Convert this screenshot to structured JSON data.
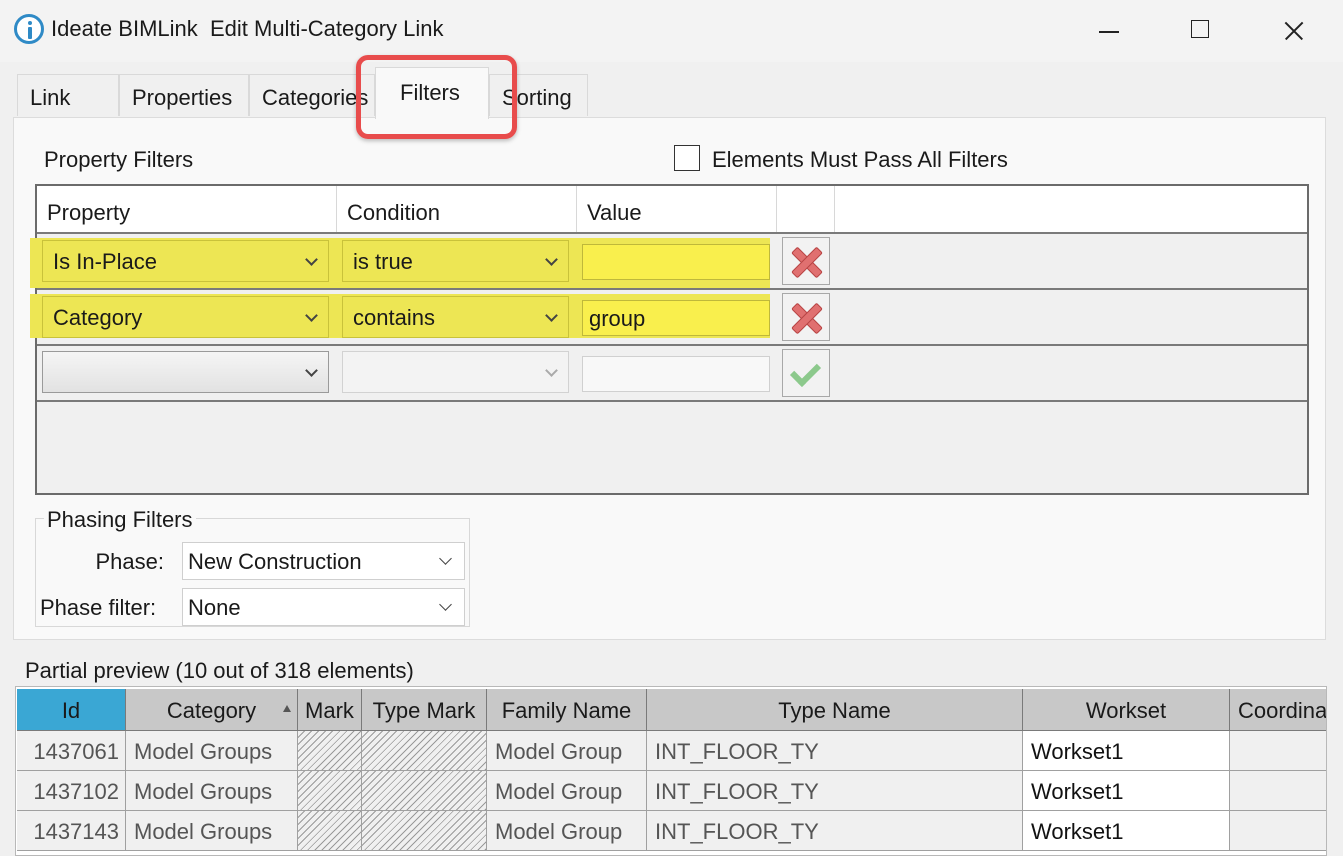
{
  "window": {
    "title": "Ideate BIMLink  Edit Multi-Category Link"
  },
  "tabs": [
    {
      "label": "Link"
    },
    {
      "label": "Properties"
    },
    {
      "label": "Categories"
    },
    {
      "label": "Filters"
    },
    {
      "label": "Sorting"
    }
  ],
  "active_tab": "Filters",
  "property_filters": {
    "label": "Property Filters",
    "must_pass_all_label": "Elements Must Pass All Filters",
    "must_pass_all_checked": false,
    "columns": [
      "Property",
      "Condition",
      "Value"
    ],
    "rows": [
      {
        "property": "Is In-Place",
        "condition": "is true",
        "value": "",
        "action": "remove-icon"
      },
      {
        "property": "Category",
        "condition": "contains",
        "value": "group",
        "action": "remove-icon"
      },
      {
        "property": "",
        "condition": "",
        "value": "",
        "action": "confirm-icon"
      }
    ],
    "highlight_color": "#ede654"
  },
  "phasing_filters": {
    "label": "Phasing Filters",
    "phase_label": "Phase:",
    "phase_value": "New Construction",
    "phase_filter_label": "Phase filter:",
    "phase_filter_value": "None"
  },
  "preview": {
    "label": "Partial preview (10 out of 318 elements)",
    "columns": [
      "Id",
      "Category",
      "Mark",
      "Type Mark",
      "Family Name",
      "Type Name",
      "Workset",
      "Coordina"
    ],
    "rows": [
      {
        "id": "1437061",
        "category": "Model Groups",
        "mark": "",
        "type_mark": "",
        "family_name": "Model Group",
        "type_name": "INT_FLOOR_TY",
        "workset": "Workset1",
        "coordinates": ""
      },
      {
        "id": "1437102",
        "category": "Model Groups",
        "mark": "",
        "type_mark": "",
        "family_name": "Model Group",
        "type_name": "INT_FLOOR_TY",
        "workset": "Workset1",
        "coordinates": ""
      },
      {
        "id": "1437143",
        "category": "Model Groups",
        "mark": "",
        "type_mark": "",
        "family_name": "Model Group",
        "type_name": "INT_FLOOR_TY",
        "workset": "Workset1",
        "coordinates": ""
      }
    ],
    "active_header_color": "#3aa7d4"
  },
  "accent_colors": {
    "tab_highlight": "#e84c4c"
  }
}
